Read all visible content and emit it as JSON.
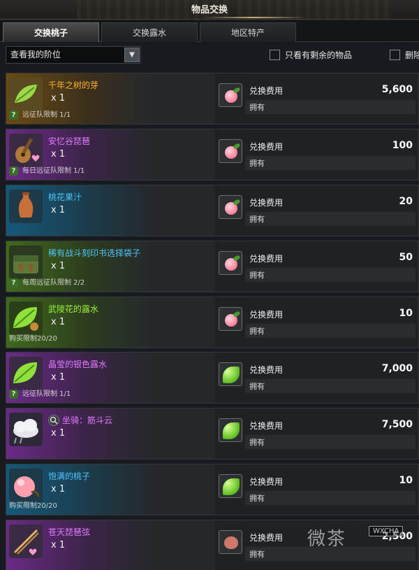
{
  "window": {
    "title": "物品交换"
  },
  "tabs": [
    {
      "label": "交换桃子",
      "active": true
    },
    {
      "label": "交换露水",
      "active": false
    },
    {
      "label": "地区特产",
      "active": false
    }
  ],
  "filter": {
    "select_value": "查看我的阶位",
    "checkbox1_label": "只看有剩余的物品",
    "checkbox2_label": "删除"
  },
  "common": {
    "cost_label": "兑换费用",
    "own_label": "拥有"
  },
  "items": [
    {
      "name": "千年之树的芽",
      "qty": "x 1",
      "limit": "远征队限制 1/1",
      "limit_icon": true,
      "cost": "5,600",
      "rarity": "orange",
      "icon": "sprout-icon",
      "cost_icon": "peach-icon"
    },
    {
      "name": "安忆谷琵琶",
      "qty": "x 1",
      "limit": "每日远征队限制 1/1",
      "limit_icon": true,
      "cost": "100",
      "rarity": "purple",
      "icon": "lute-icon",
      "cost_icon": "peach-icon"
    },
    {
      "name": "桃花果汁",
      "qty": "x 1",
      "limit": "",
      "limit_icon": false,
      "cost": "20",
      "rarity": "blue",
      "icon": "vase-icon",
      "cost_icon": "peach-icon"
    },
    {
      "name": "稀有战斗刻印书选择袋子",
      "qty": "x 1",
      "limit": "每周远征队限制 2/2",
      "limit_icon": true,
      "cost": "50",
      "rarity": "green",
      "icon": "bag-icon",
      "cost_icon": "peach-icon"
    },
    {
      "name": "武陵花的露水",
      "qty": "x 1",
      "limit": "购买限制20/20",
      "limit_icon": false,
      "cost": "10",
      "rarity": "green",
      "icon": "leaf-dew-icon",
      "cost_icon": "peach-icon"
    },
    {
      "name": "晶莹的银色露水",
      "qty": "x 1",
      "limit": "远征队限制 1/1",
      "limit_icon": true,
      "cost": "7,000",
      "rarity": "purple",
      "icon": "leaf-dew-icon",
      "cost_icon": "dew-icon"
    },
    {
      "name": "坐骑：筋斗云",
      "qty": "x 1",
      "limit": "",
      "limit_icon": false,
      "cost": "7,500",
      "rarity": "purple",
      "icon": "cloud-icon",
      "cost_icon": "dew-icon"
    },
    {
      "name": "饱满的桃子",
      "qty": "x 1",
      "limit": "购买限制20/20",
      "limit_icon": false,
      "cost": "10",
      "rarity": "blue",
      "icon": "peach-icon",
      "cost_icon": "dew-icon"
    },
    {
      "name": "苍天琵琶弦",
      "qty": "x 1",
      "limit": "",
      "limit_icon": false,
      "cost": "2,500",
      "rarity": "purple",
      "icon": "strings-icon",
      "cost_icon": "heart-stone-icon"
    }
  ],
  "watermark": {
    "text": "微茶",
    "badge": "WXCHA"
  }
}
